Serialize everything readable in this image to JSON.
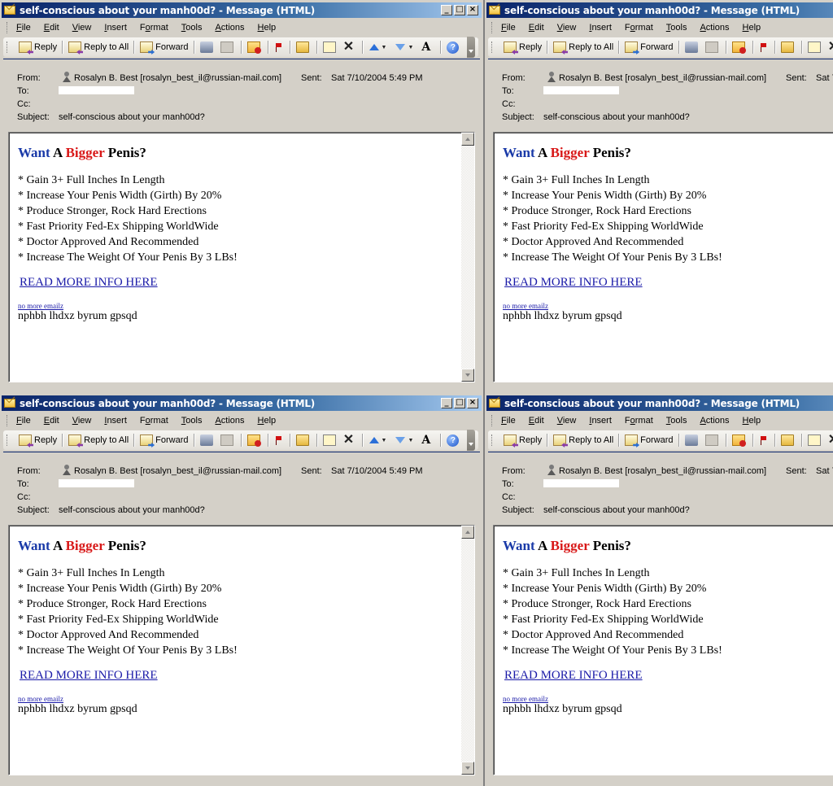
{
  "window": {
    "title": "self-conscious about your manh00d? - Message (HTML)",
    "controls": {
      "minimize": "_",
      "maximize": "□",
      "close": "×"
    }
  },
  "menu": [
    {
      "label": "File",
      "accel": "F"
    },
    {
      "label": "Edit",
      "accel": "E"
    },
    {
      "label": "View",
      "accel": "V"
    },
    {
      "label": "Insert",
      "accel": "I"
    },
    {
      "label": "Format",
      "accel": "o"
    },
    {
      "label": "Tools",
      "accel": "T"
    },
    {
      "label": "Actions",
      "accel": "A"
    },
    {
      "label": "Help",
      "accel": "H"
    }
  ],
  "toolbar": {
    "reply": "Reply",
    "reply_all": "Reply to All",
    "forward": "Forward",
    "icons": [
      "reply-icon",
      "reply-all-icon",
      "forward-icon",
      "print-icon",
      "copy-icon",
      "block-sender-icon",
      "flag-icon",
      "move-to-folder-icon",
      "move-icon",
      "delete-icon",
      "previous-item-icon",
      "next-item-icon",
      "font-size-icon",
      "help-icon",
      "toolbar-options-icon"
    ],
    "font_glyph": "A",
    "help_glyph": "?"
  },
  "header": {
    "from_label": "From:",
    "from_value": "Rosalyn B. Best [rosalyn_best_il@russian-mail.com]",
    "sent_label": "Sent:",
    "sent_value": "Sat 7/10/2004 5:49 PM",
    "to_label": "To:",
    "cc_label": "Cc:",
    "subject_label": "Subject:",
    "subject_value": "self-conscious about your manh00d?"
  },
  "body": {
    "headline": {
      "word1": "Want",
      "word2": " A ",
      "word3": "Bigger",
      "word4": " Penis?"
    },
    "bullets": [
      "* Gain 3+ Full Inches In Length",
      "* Increase Your Penis Width (Girth) By 20%",
      "* Produce Stronger, Rock Hard Erections",
      "* Fast Priority Fed-Ex Shipping WorldWide",
      "* Doctor Approved And Recommended",
      "* Increase The Weight Of Your Penis By 3 LBs!"
    ],
    "read_more_link": "READ MORE INFO HERE",
    "unsubscribe_link": "no more emailz",
    "random_text": "nphbh lhdxz byrum gpsqd"
  },
  "colors": {
    "titlebar_start": "#0a246a",
    "titlebar_end": "#a6caf0",
    "headline_blue": "#1a3aa8",
    "headline_red": "#d81818",
    "link": "#1a1aa8"
  }
}
